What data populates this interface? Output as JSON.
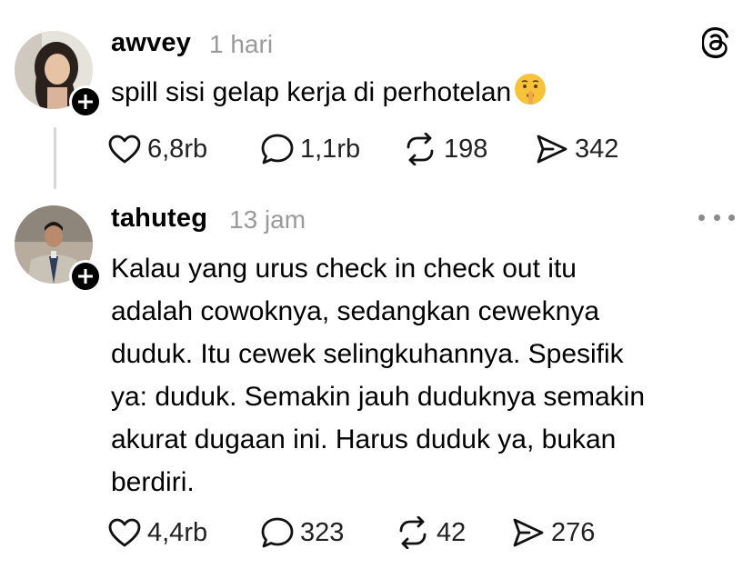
{
  "post1": {
    "username": "awvey",
    "time": "1 hari",
    "text": "spill sisi gelap kerja di perhotelan",
    "emoji_icon": "shushing-face-emoji",
    "likes": "6,8rb",
    "replies": "1,1rb",
    "reposts": "198",
    "shares": "342"
  },
  "post2": {
    "username": "tahuteg",
    "time": "13 jam",
    "text_lines": [
      "Kalau yang urus check in check out itu",
      "adalah cowoknya, sedangkan ceweknya",
      "duduk. Itu cewek selingkuhannya. Spesifik",
      "ya: duduk. Semakin jauh duduknya semakin",
      "akurat dugaan ini. Harus duduk ya, bukan",
      "berdiri."
    ],
    "likes": "4,4rb",
    "replies": "323",
    "reposts": "42",
    "shares": "276"
  },
  "icons": {
    "app_logo": "threads-logo-icon",
    "more": "more-horizontal-icon",
    "like": "heart-icon",
    "reply": "speech-bubble-icon",
    "repost": "repost-icon",
    "share": "send-icon",
    "follow": "plus-icon"
  },
  "colors": {
    "text": "#000000",
    "muted": "#9a9a9a",
    "thread_line": "#d6d6d6"
  }
}
